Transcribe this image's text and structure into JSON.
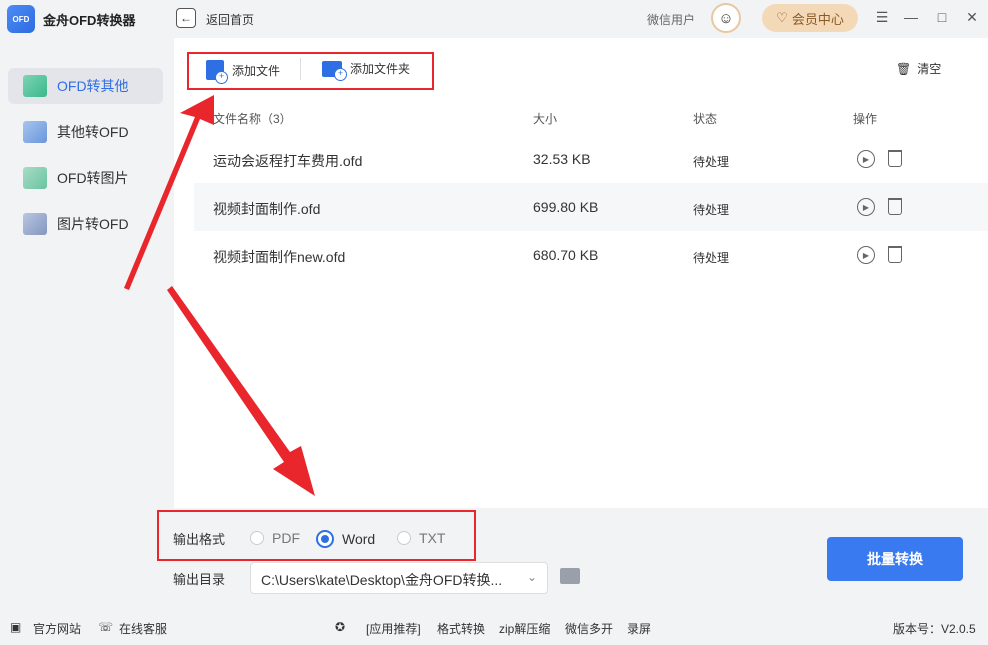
{
  "app": {
    "title": "金舟OFD转换器",
    "logo_text": "OFD"
  },
  "header": {
    "back_label": "返回首页",
    "user_name": "微信用户",
    "vip_label": "会员中心"
  },
  "sidebar": {
    "items": [
      {
        "label": "OFD转其他",
        "active": true
      },
      {
        "label": "其他转OFD",
        "active": false
      },
      {
        "label": "OFD转图片",
        "active": false
      },
      {
        "label": "图片转OFD",
        "active": false
      }
    ]
  },
  "toolbar": {
    "add_file": "添加文件",
    "add_folder": "添加文件夹",
    "clear": "清空"
  },
  "table": {
    "headers": {
      "name": "文件名称（3）",
      "size": "大小",
      "status": "状态",
      "actions": "操作"
    },
    "rows": [
      {
        "name": "运动会返程打车费用.ofd",
        "size": "32.53 KB",
        "status": "待处理"
      },
      {
        "name": "视频封面制作.ofd",
        "size": "699.80 KB",
        "status": "待处理"
      },
      {
        "name": "视频封面制作new.ofd",
        "size": "680.70 KB",
        "status": "待处理"
      }
    ]
  },
  "output": {
    "format_label": "输出格式",
    "formats": [
      {
        "label": "PDF",
        "checked": false
      },
      {
        "label": "Word",
        "checked": true
      },
      {
        "label": "TXT",
        "checked": false
      }
    ],
    "dir_label": "输出目录",
    "dir_value": "C:\\Users\\kate\\Desktop\\金舟OFD转换..."
  },
  "convert_label": "批量转换",
  "footer": {
    "website": "官方网站",
    "support": "在线客服",
    "recommend": "[应用推荐]",
    "links": [
      "格式转换",
      "zip解压缩",
      "微信多开",
      "录屏"
    ],
    "version": "版本号：V2.0.5"
  },
  "colors": {
    "accent": "#3a7af0",
    "annotation": "#e8262c",
    "vip": "#f4d9b8"
  }
}
